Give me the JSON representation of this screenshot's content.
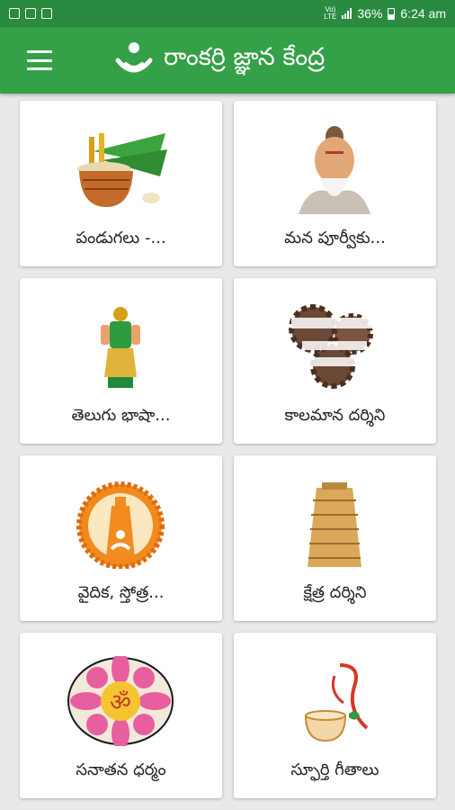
{
  "status_bar": {
    "network_top": "Vo)",
    "network_bottom": "LTE",
    "battery": "36%",
    "time": "6:24 am"
  },
  "app_bar": {
    "title": "రాంకర్రి జ్ఞాన కేంద్ర",
    "logo_icon": "meditating-person-logo",
    "menu_icon": "hamburger-menu-icon",
    "color": "#34a047"
  },
  "tiles": [
    {
      "label": "పండుగలు -...",
      "icon": "festival-pot-icon"
    },
    {
      "label": "మన పూర్వీకు...",
      "icon": "sage-portrait-icon"
    },
    {
      "label": "తెలుగు భాషా...",
      "icon": "telugu-thalli-statue-icon"
    },
    {
      "label": "కాలమాన దర్శిని",
      "icon": "calendar-gears-icon"
    },
    {
      "label": "వైదిక, స్తోత్ర...",
      "icon": "temple-meditation-emblem-icon"
    },
    {
      "label": "క్షేత్ర దర్శిని",
      "icon": "temple-tower-icon"
    },
    {
      "label": "సనాతన ధర్మం",
      "icon": "om-lotus-icon"
    },
    {
      "label": "స్ఫూర్తి గీతాలు",
      "icon": "veena-pot-icon"
    }
  ]
}
